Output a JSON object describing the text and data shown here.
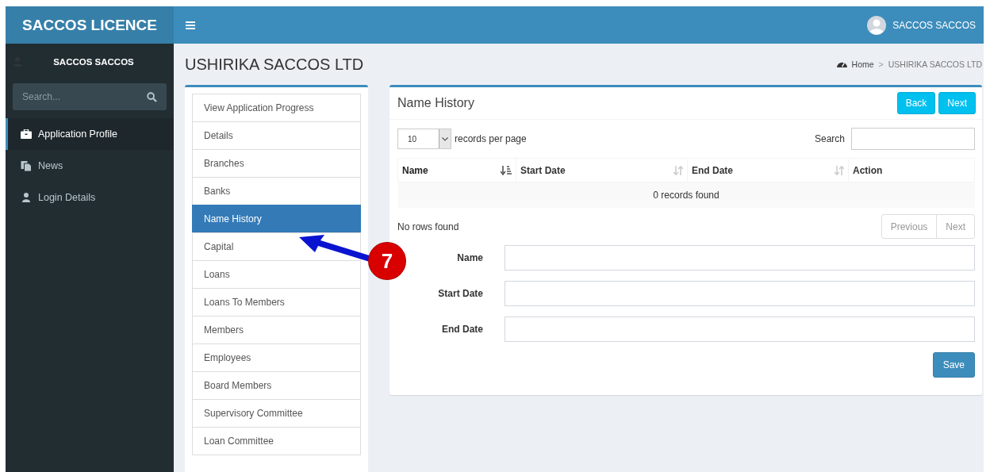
{
  "header": {
    "brand": "SACCOS LICENCE",
    "user_name": "SACCOS SACCOS"
  },
  "sidebar": {
    "user_name": "SACCOS SACCOS",
    "search": {
      "placeholder": "Search..."
    },
    "items": [
      {
        "label": "Application Profile",
        "selected": true
      },
      {
        "label": "News",
        "selected": false
      },
      {
        "label": "Login Details",
        "selected": false
      }
    ]
  },
  "page": {
    "title": "USHIRIKA SACCOS LTD",
    "breadcrumb": [
      "Home",
      "USHIRIKA SACCOS LTD"
    ],
    "breadcrumb_separator": ">"
  },
  "sections": [
    {
      "label": "View Application Progress",
      "selected": false
    },
    {
      "label": "Details",
      "selected": false
    },
    {
      "label": "Branches",
      "selected": false
    },
    {
      "label": "Banks",
      "selected": false
    },
    {
      "label": "Name History",
      "selected": true
    },
    {
      "label": "Capital",
      "selected": false
    },
    {
      "label": "Loans",
      "selected": false
    },
    {
      "label": "Loans To Members",
      "selected": false
    },
    {
      "label": "Members",
      "selected": false
    },
    {
      "label": "Employees",
      "selected": false
    },
    {
      "label": "Board Members",
      "selected": false
    },
    {
      "label": "Supervisory Committee",
      "selected": false
    },
    {
      "label": "Loan Committee",
      "selected": false
    }
  ],
  "panel": {
    "title": "Name History",
    "buttons": [
      "Back",
      "Next"
    ],
    "length_select": {
      "value": "10",
      "label": "records per page"
    },
    "search": {
      "label": "Search"
    },
    "table": {
      "columns": [
        {
          "label": "Name",
          "sortable": true,
          "sorted": true
        },
        {
          "label": "Start Date",
          "sortable": true,
          "sorted": false
        },
        {
          "label": "End Date",
          "sortable": true,
          "sorted": false
        },
        {
          "label": "Action",
          "sortable": false,
          "sorted": false
        }
      ],
      "empty_message": "0 records found"
    },
    "info": "No rows found",
    "pagination": [
      "Previous",
      "Next"
    ],
    "form": {
      "fields": [
        {
          "label": "Name"
        },
        {
          "label": "Start Date"
        },
        {
          "label": "End Date"
        }
      ],
      "submit": "Save"
    }
  },
  "annotation": {
    "number": "7"
  }
}
